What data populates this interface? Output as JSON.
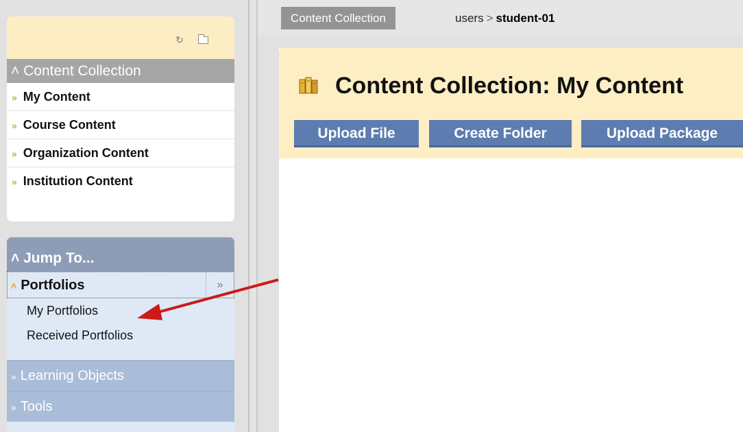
{
  "sidebar": {
    "content_collection": {
      "title": "Content Collection",
      "items": [
        {
          "label": "My Content"
        },
        {
          "label": "Course Content"
        },
        {
          "label": "Organization Content"
        },
        {
          "label": "Institution Content"
        }
      ]
    },
    "jump_to": {
      "title": "Jump To...",
      "portfolios": {
        "label": "Portfolios",
        "items": [
          {
            "label": "My Portfolios"
          },
          {
            "label": "Received Portfolios"
          }
        ]
      },
      "learning_objects": "Learning Objects",
      "tools": "Tools"
    }
  },
  "breadcrumb": {
    "tag": "Content Collection",
    "path_root": "users",
    "path_current": "student-01"
  },
  "main": {
    "title": "Content Collection: My Content",
    "buttons": {
      "upload_file": "Upload File",
      "create_folder": "Create Folder",
      "upload_package": "Upload Package"
    }
  },
  "colors": {
    "header_bg": "#fdeec4",
    "button_bg": "#5d7db0",
    "accent_chevron": "#d6a81f",
    "annotation_arrow": "#cc1a1a"
  }
}
